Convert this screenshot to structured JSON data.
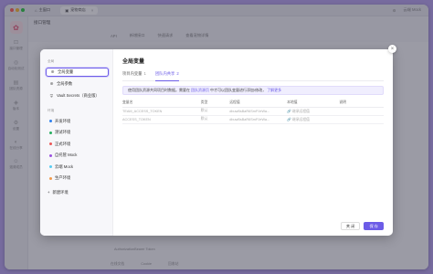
{
  "window": {
    "tabs": [
      {
        "label": "主窗口",
        "active": false
      },
      {
        "label": "宠物商店",
        "active": true
      }
    ],
    "right_actions": [
      "⚙",
      "云端 Mock"
    ]
  },
  "app_sidebar": {
    "items": [
      "接口管理",
      "自动化测试",
      "团队资源",
      "版本",
      "设置",
      "在线分享",
      "邀请成员"
    ]
  },
  "background": {
    "header_title": "接口管理",
    "tabs": [
      "API",
      "新增接口",
      "快速请求",
      "查看宠物详情"
    ],
    "status": [
      "在线文档",
      "Cookie",
      "回收站"
    ],
    "hint_line": "AuthorizationBearer Token"
  },
  "modal": {
    "sections": {
      "global": "全局",
      "environments": "环境"
    },
    "global_items": [
      {
        "label": "全局变量",
        "icon": "⊕",
        "selected": true
      },
      {
        "label": "全局参数",
        "icon": "⊕",
        "selected": false
      },
      {
        "label": "Vault Secrets（商业版）",
        "icon": "⛨",
        "selected": false
      }
    ],
    "environments": [
      {
        "label": "开发环境",
        "color": "#2f80ed"
      },
      {
        "label": "测试环境",
        "color": "#27ae60"
      },
      {
        "label": "正式环境",
        "color": "#eb5757"
      },
      {
        "label": "自托管 Mock",
        "color": "#9b51e0"
      },
      {
        "label": "云端 Mock",
        "color": "#56ccf2"
      },
      {
        "label": "生产环境",
        "color": "#f2994a"
      }
    ],
    "new_env_label": "新建环境",
    "title": "全局变量",
    "tabs": [
      {
        "label": "项目内变量",
        "count": "1",
        "active": false
      },
      {
        "label": "团队内共享",
        "count": "2",
        "active": true
      }
    ],
    "notice": {
      "before": "使用团队资源共同项目时数据。需要在",
      "link1": "团队资源页",
      "middle": "中才可以团队变量进行添加/修改，",
      "link2": "了解更多"
    },
    "table": {
      "headers": [
        "变量名",
        "类型",
        "远程值",
        "本地值",
        "说明"
      ],
      "rows": [
        {
          "name": "TEAM_ACCESS_TOKEN",
          "type": "默认",
          "remote": "dbuwBsBaR6SmPJeWa...",
          "local": "继承远程值",
          "desc": ""
        },
        {
          "name": "ACCESS_TOKEN",
          "type": "默认",
          "remote": "dbuwBsBaR6SmPJeWa...",
          "local": "继承远程值",
          "desc": ""
        }
      ]
    },
    "cancel_label": "关 闭",
    "save_label": "保 存"
  }
}
